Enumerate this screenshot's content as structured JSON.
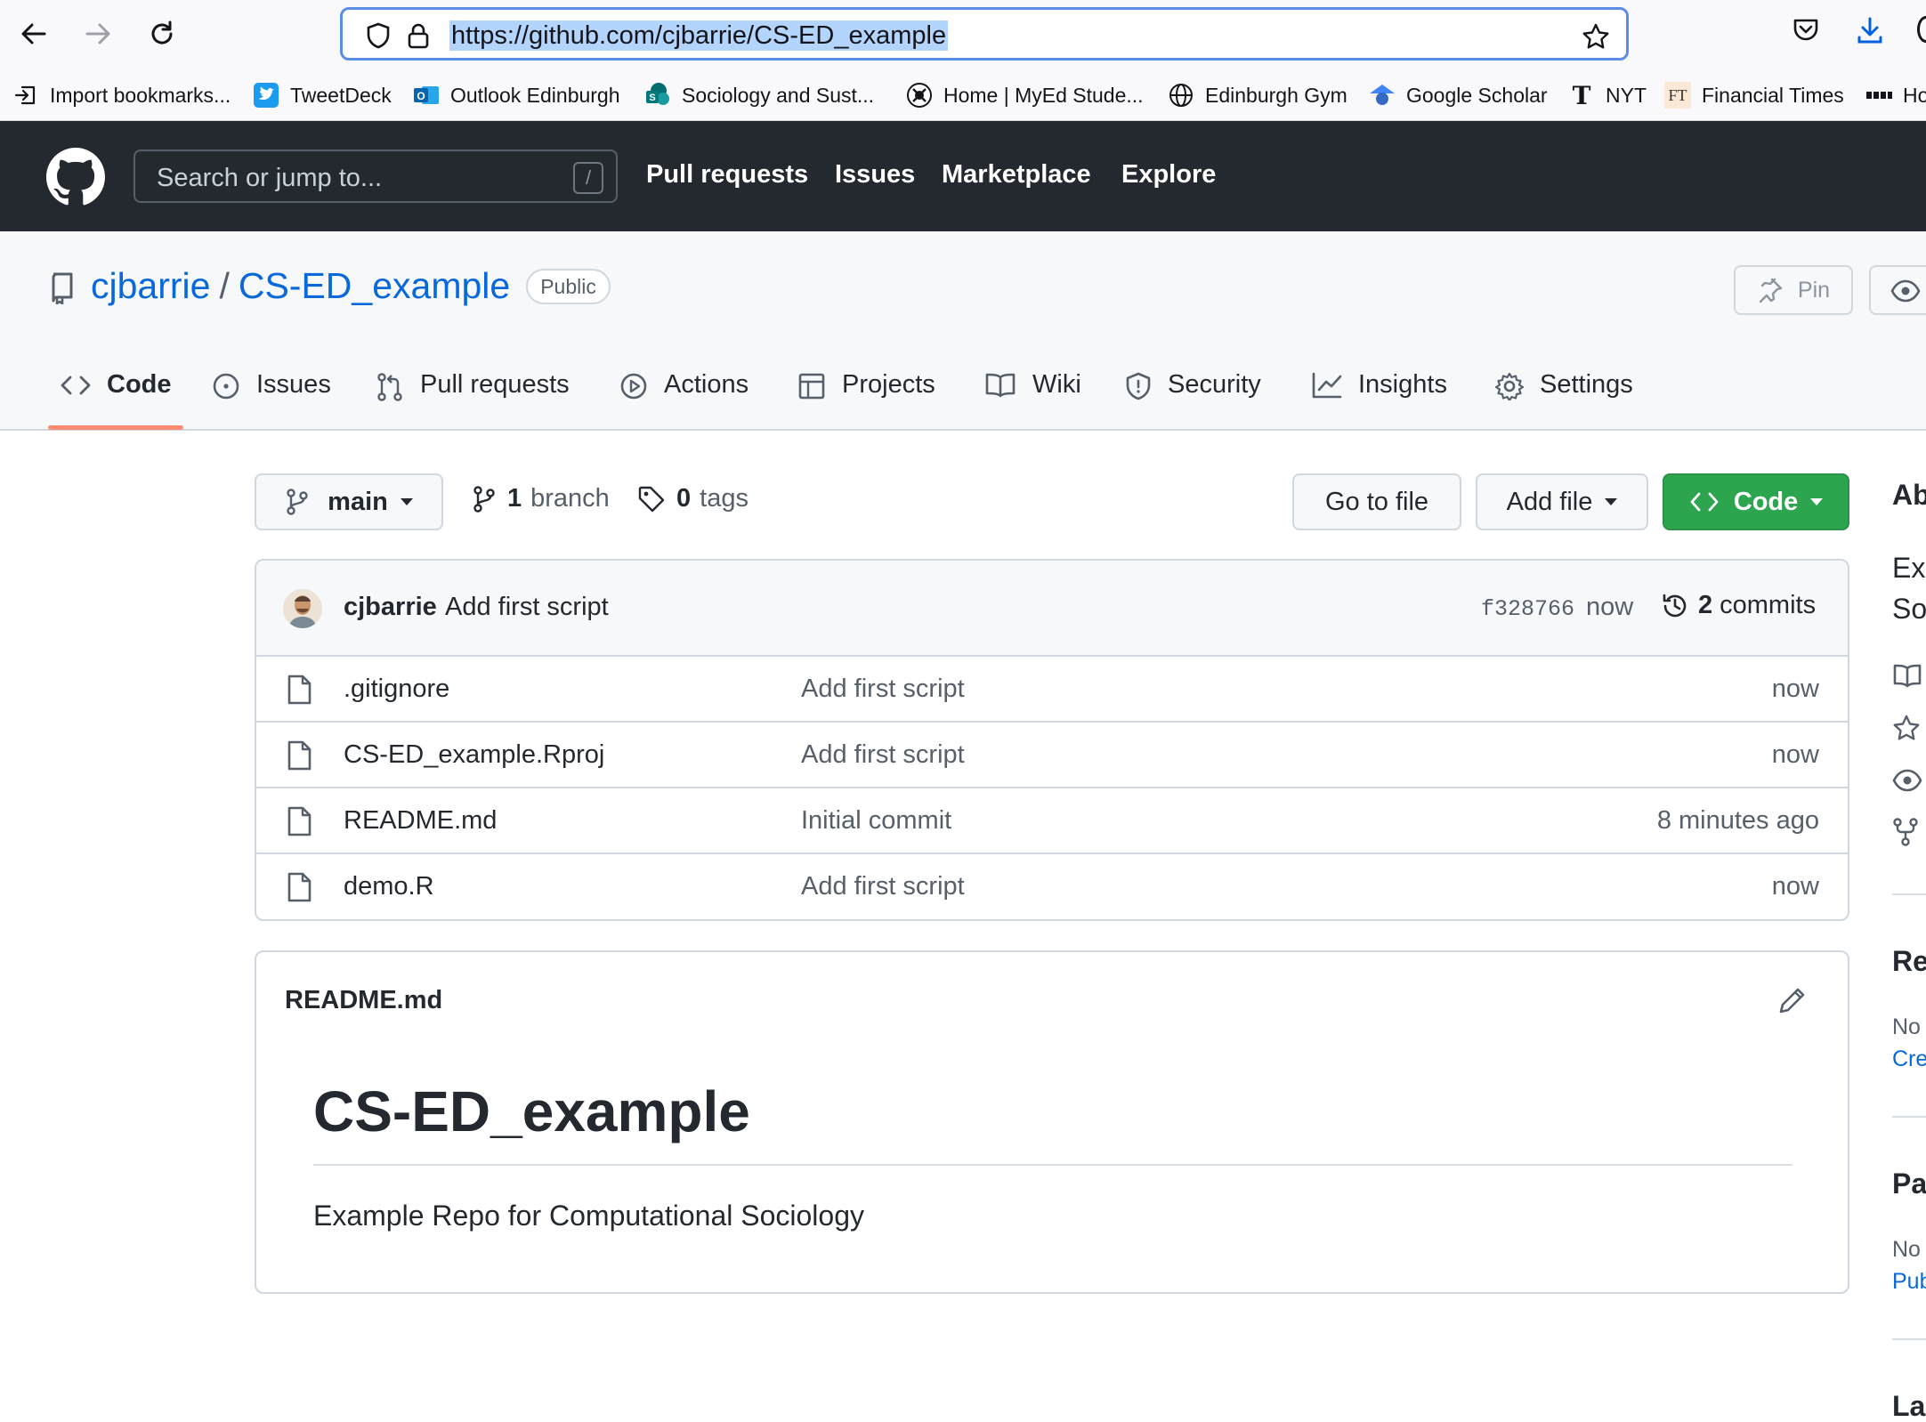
{
  "browser": {
    "url": "https://github.com/cjbarrie/CS-ED_example",
    "bookmarks": [
      {
        "label": "Import bookmarks...",
        "icon": "import-icon"
      },
      {
        "label": "TweetDeck",
        "icon": "tweetdeck-icon"
      },
      {
        "label": "Outlook Edinburgh",
        "icon": "outlook-icon"
      },
      {
        "label": "Sociology and Sust...",
        "icon": "sharepoint-icon"
      },
      {
        "label": "Home | MyEd Stude...",
        "icon": "myed-icon"
      },
      {
        "label": "Edinburgh Gym",
        "icon": "globe-icon"
      },
      {
        "label": "Google Scholar",
        "icon": "scholar-icon"
      },
      {
        "label": "NYT",
        "icon": "nyt-icon"
      },
      {
        "label": "Financial Times",
        "icon": "ft-icon"
      },
      {
        "label": "Ho",
        "icon": "bookmark-icon"
      }
    ]
  },
  "github": {
    "search_placeholder": "Search or jump to...",
    "search_shortcut": "/",
    "nav": [
      "Pull requests",
      "Issues",
      "Marketplace",
      "Explore"
    ]
  },
  "repo": {
    "owner": "cjbarrie",
    "separator": "/",
    "name": "CS-ED_example",
    "visibility": "Public",
    "pin_label": "Pin",
    "tabs": [
      {
        "label": "Code",
        "icon": "code-icon",
        "active": true
      },
      {
        "label": "Issues",
        "icon": "issue-icon"
      },
      {
        "label": "Pull requests",
        "icon": "pull-request-icon"
      },
      {
        "label": "Actions",
        "icon": "play-icon"
      },
      {
        "label": "Projects",
        "icon": "table-icon"
      },
      {
        "label": "Wiki",
        "icon": "book-icon"
      },
      {
        "label": "Security",
        "icon": "shield-icon"
      },
      {
        "label": "Insights",
        "icon": "graph-icon"
      },
      {
        "label": "Settings",
        "icon": "gear-icon"
      }
    ]
  },
  "toolbar": {
    "branch": "main",
    "branch_count": "1",
    "branch_label": "branch",
    "tag_count": "0",
    "tag_label": "tags",
    "go_to_file": "Go to file",
    "add_file": "Add file",
    "code": "Code"
  },
  "latest_commit": {
    "author": "cjbarrie",
    "message": "Add first script",
    "sha": "f328766",
    "time": "now",
    "commit_count": "2",
    "commit_label": "commits"
  },
  "files": [
    {
      "name": ".gitignore",
      "commit": "Add first script",
      "age": "now"
    },
    {
      "name": "CS-ED_example.Rproj",
      "commit": "Add first script",
      "age": "now"
    },
    {
      "name": "README.md",
      "commit": "Initial commit",
      "age": "8 minutes ago"
    },
    {
      "name": "demo.R",
      "commit": "Add first script",
      "age": "now"
    }
  ],
  "readme": {
    "label": "README.md",
    "heading": "CS-ED_example",
    "body": "Example Repo for Computational Sociology"
  },
  "sidebar": {
    "about": "Ab",
    "desc_line1": "Ex",
    "desc_line2": "So",
    "releases": "Re",
    "releases_none": "No",
    "releases_link": "Cre",
    "packages": "Pa",
    "packages_none": "No",
    "packages_link": "Pub",
    "languages": "La"
  },
  "colors": {
    "header_bg": "#24292f",
    "link": "#0969da",
    "code_button": "#2da44e",
    "tab_underline": "#fd8c73",
    "url_focus": "#5b8de6"
  }
}
